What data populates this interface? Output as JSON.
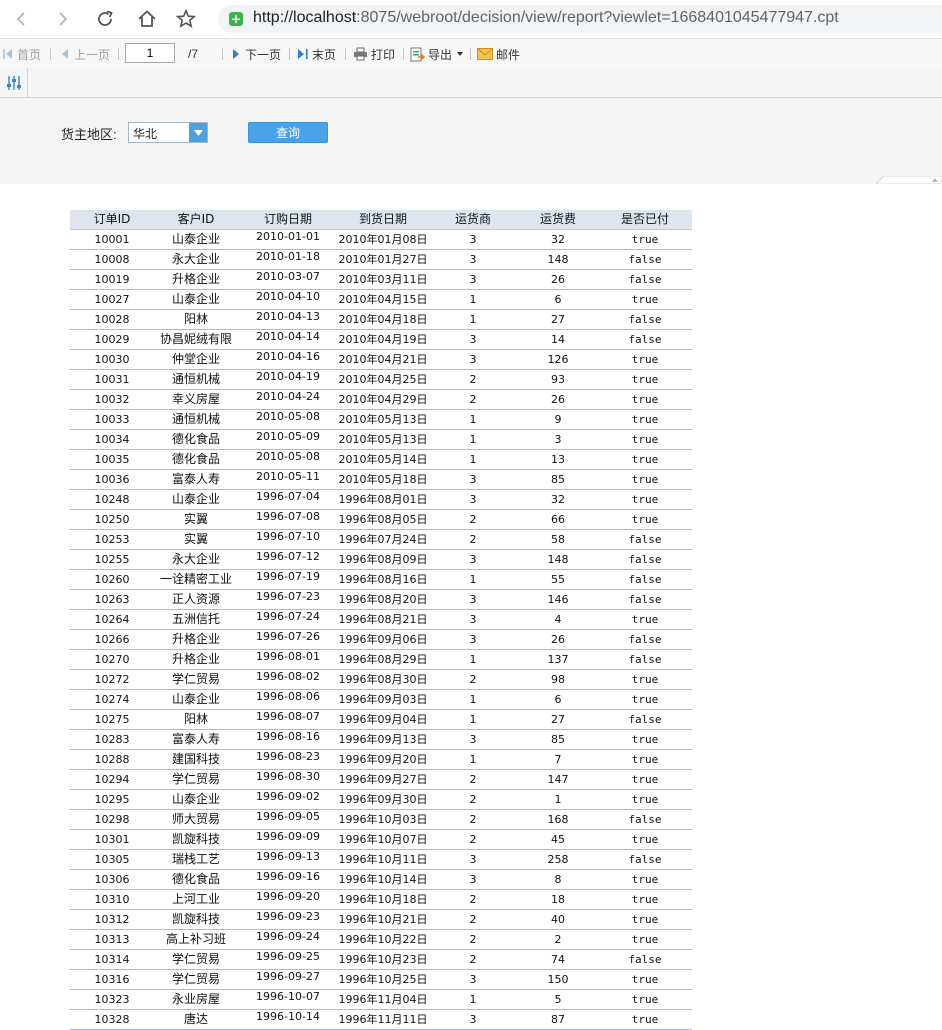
{
  "browser": {
    "url_host": "http://localhost",
    "url_rest": ":8075/webroot/decision/view/report?viewlet=1668401045477947.cpt"
  },
  "toolbar": {
    "first": "首页",
    "prev": "上一页",
    "page_value": "1",
    "page_total": "/7",
    "next": "下一页",
    "last": "末页",
    "print": "打印",
    "export": "导出",
    "mail": "邮件"
  },
  "params": {
    "region_label": "货主地区:",
    "region_value": "华北",
    "query_button": "查询"
  },
  "table": {
    "columns": [
      "订单ID",
      "客户ID",
      "订购日期",
      "到货日期",
      "运货商",
      "运货费",
      "是否已付"
    ],
    "rows": [
      [
        "10001",
        "山泰企业",
        "2010-01-01",
        "2010年01月08日",
        "3",
        "32",
        "true"
      ],
      [
        "10008",
        "永大企业",
        "2010-01-18",
        "2010年01月27日",
        "3",
        "148",
        "false"
      ],
      [
        "10019",
        "升格企业",
        "2010-03-07",
        "2010年03月11日",
        "3",
        "26",
        "false"
      ],
      [
        "10027",
        "山泰企业",
        "2010-04-10",
        "2010年04月15日",
        "1",
        "6",
        "true"
      ],
      [
        "10028",
        "阳林",
        "2010-04-13",
        "2010年04月18日",
        "1",
        "27",
        "false"
      ],
      [
        "10029",
        "协昌妮绒有限",
        "2010-04-14",
        "2010年04月19日",
        "3",
        "14",
        "false"
      ],
      [
        "10030",
        "仲堂企业",
        "2010-04-16",
        "2010年04月21日",
        "3",
        "126",
        "true"
      ],
      [
        "10031",
        "通恒机械",
        "2010-04-19",
        "2010年04月25日",
        "2",
        "93",
        "true"
      ],
      [
        "10032",
        "幸义房屋",
        "2010-04-24",
        "2010年04月29日",
        "2",
        "26",
        "true"
      ],
      [
        "10033",
        "通恒机械",
        "2010-05-08",
        "2010年05月13日",
        "1",
        "9",
        "true"
      ],
      [
        "10034",
        "德化食品",
        "2010-05-09",
        "2010年05月13日",
        "1",
        "3",
        "true"
      ],
      [
        "10035",
        "德化食品",
        "2010-05-08",
        "2010年05月14日",
        "1",
        "13",
        "true"
      ],
      [
        "10036",
        "富泰人寿",
        "2010-05-11",
        "2010年05月18日",
        "3",
        "85",
        "true"
      ],
      [
        "10248",
        "山泰企业",
        "1996-07-04",
        "1996年08月01日",
        "3",
        "32",
        "true"
      ],
      [
        "10250",
        "实翼",
        "1996-07-08",
        "1996年08月05日",
        "2",
        "66",
        "true"
      ],
      [
        "10253",
        "实翼",
        "1996-07-10",
        "1996年07月24日",
        "2",
        "58",
        "false"
      ],
      [
        "10255",
        "永大企业",
        "1996-07-12",
        "1996年08月09日",
        "3",
        "148",
        "false"
      ],
      [
        "10260",
        "一诠精密工业",
        "1996-07-19",
        "1996年08月16日",
        "1",
        "55",
        "false"
      ],
      [
        "10263",
        "正人资源",
        "1996-07-23",
        "1996年08月20日",
        "3",
        "146",
        "false"
      ],
      [
        "10264",
        "五洲信托",
        "1996-07-24",
        "1996年08月21日",
        "3",
        "4",
        "true"
      ],
      [
        "10266",
        "升格企业",
        "1996-07-26",
        "1996年09月06日",
        "3",
        "26",
        "false"
      ],
      [
        "10270",
        "升格企业",
        "1996-08-01",
        "1996年08月29日",
        "1",
        "137",
        "false"
      ],
      [
        "10272",
        "学仁贸易",
        "1996-08-02",
        "1996年08月30日",
        "2",
        "98",
        "true"
      ],
      [
        "10274",
        "山泰企业",
        "1996-08-06",
        "1996年09月03日",
        "1",
        "6",
        "true"
      ],
      [
        "10275",
        "阳林",
        "1996-08-07",
        "1996年09月04日",
        "1",
        "27",
        "false"
      ],
      [
        "10283",
        "富泰人寿",
        "1996-08-16",
        "1996年09月13日",
        "3",
        "85",
        "true"
      ],
      [
        "10288",
        "建国科技",
        "1996-08-23",
        "1996年09月20日",
        "1",
        "7",
        "true"
      ],
      [
        "10294",
        "学仁贸易",
        "1996-08-30",
        "1996年09月27日",
        "2",
        "147",
        "true"
      ],
      [
        "10295",
        "山泰企业",
        "1996-09-02",
        "1996年09月30日",
        "2",
        "1",
        "true"
      ],
      [
        "10298",
        "师大贸易",
        "1996-09-05",
        "1996年10月03日",
        "2",
        "168",
        "false"
      ],
      [
        "10301",
        "凯旋科技",
        "1996-09-09",
        "1996年10月07日",
        "2",
        "45",
        "true"
      ],
      [
        "10305",
        "瑞栈工艺",
        "1996-09-13",
        "1996年10月11日",
        "3",
        "258",
        "false"
      ],
      [
        "10306",
        "德化食品",
        "1996-09-16",
        "1996年10月14日",
        "3",
        "8",
        "true"
      ],
      [
        "10310",
        "上河工业",
        "1996-09-20",
        "1996年10月18日",
        "2",
        "18",
        "true"
      ],
      [
        "10312",
        "凯旋科技",
        "1996-09-23",
        "1996年10月21日",
        "2",
        "40",
        "true"
      ],
      [
        "10313",
        "高上补习班",
        "1996-09-24",
        "1996年10月22日",
        "2",
        "2",
        "true"
      ],
      [
        "10314",
        "学仁贸易",
        "1996-09-25",
        "1996年10月23日",
        "2",
        "74",
        "false"
      ],
      [
        "10316",
        "学仁贸易",
        "1996-09-27",
        "1996年10月25日",
        "3",
        "150",
        "true"
      ],
      [
        "10323",
        "永业房屋",
        "1996-10-07",
        "1996年11月04日",
        "1",
        "5",
        "true"
      ],
      [
        "10328",
        "唐达",
        "1996-10-14",
        "1996年11月11日",
        "3",
        "87",
        "true"
      ]
    ]
  }
}
